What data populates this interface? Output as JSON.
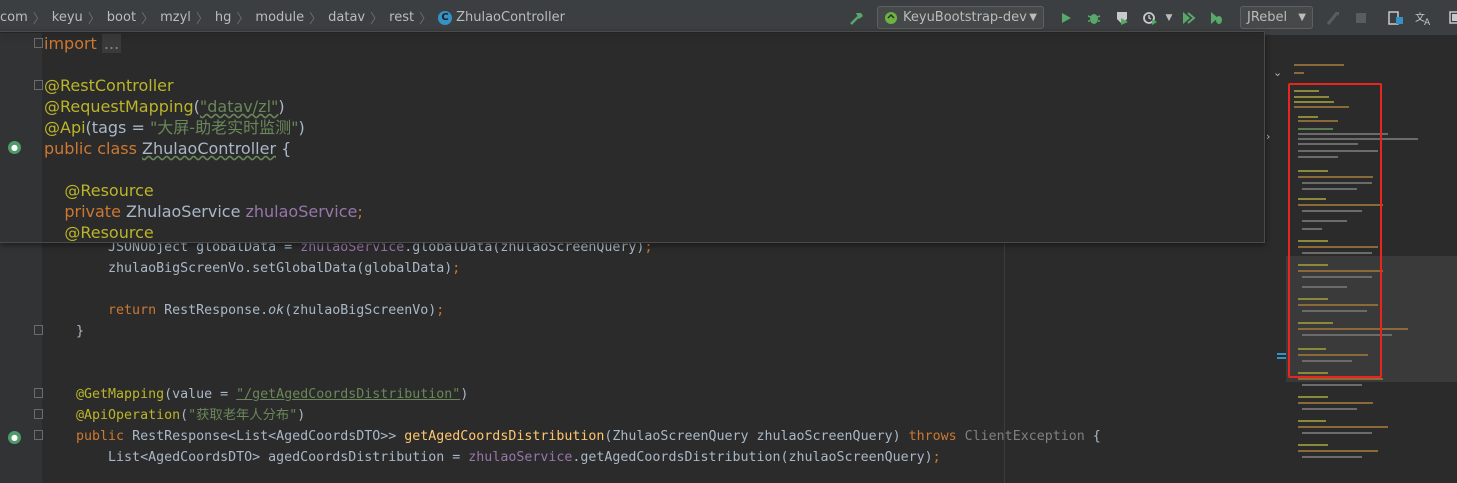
{
  "breadcrumbs": [
    "com",
    "keyu",
    "boot",
    "mzyl",
    "hg",
    "module",
    "datav",
    "rest",
    "ZhulaoController"
  ],
  "toolbar": {
    "run_config": "KeyuBootstrap-dev",
    "jrebel": "JRebel"
  },
  "popup": {
    "import_kw": "import",
    "import_fold": "...",
    "rest_controller": "@RestController",
    "request_mapping": "@RequestMapping",
    "request_mapping_value": "\"datav/zl\"",
    "api": "@Api",
    "api_args_pre": "(tags = ",
    "api_tags": "\"大屏-助老实时监测\"",
    "class_public": "public class ",
    "class_name": "ZhulaoController",
    "class_brace": " {",
    "resource1": "@Resource",
    "private_kw": "private ",
    "service_type": "ZhulaoService ",
    "service_field": "zhulaoService",
    "semicolon": ";",
    "resource2": "@Resource"
  },
  "code": {
    "line1_pre": "        JSONObject globalData = ",
    "line1_field": "zhulaoService",
    "line1_mid": ".globalData(zhulaoScreenQuery)",
    "line1_end": ";",
    "line2": "        zhulaoBigScreenVo.setGlobalData(globalData)",
    "line2_end": ";",
    "line3_kw": "        return ",
    "line3_mid": "RestResponse.",
    "line3_ok": "ok",
    "line3_end": "(zhulaoBigScreenVo)",
    "line3_semi": ";",
    "line4": "    }",
    "line5_ann": "    @GetMapping",
    "line5_pre": "(value = ",
    "line5_str": "\"/getAgedCoordsDistribution\"",
    "line5_end": ")",
    "line6_ann": "    @ApiOperation",
    "line6_pre": "(",
    "line6_str": "\"获取老年人分布\"",
    "line6_end": ")",
    "line7_kw": "    public ",
    "line7_type": "RestResponse<List<AgedCoordsDTO>> ",
    "line7_method": "getAgedCoordsDistribution",
    "line7_params": "(ZhulaoScreenQuery zhulaoScreenQuery) ",
    "line7_throws": "throws ",
    "line7_exc": "ClientException",
    "line7_brace": " {",
    "line8_pre": "        List<AgedCoordsDTO> agedCoordsDistribution = ",
    "line8_field": "zhulaoService",
    "line8_end": ".getAgedCoordsDistribution(zhulaoScreenQuery)",
    "line8_semi": ";"
  },
  "colors": {
    "keyword": "#cc7832",
    "annotation": "#bbb529",
    "string": "#6a8759",
    "field": "#9876aa",
    "method": "#ffc66d",
    "highlight_box": "#e8261d"
  }
}
